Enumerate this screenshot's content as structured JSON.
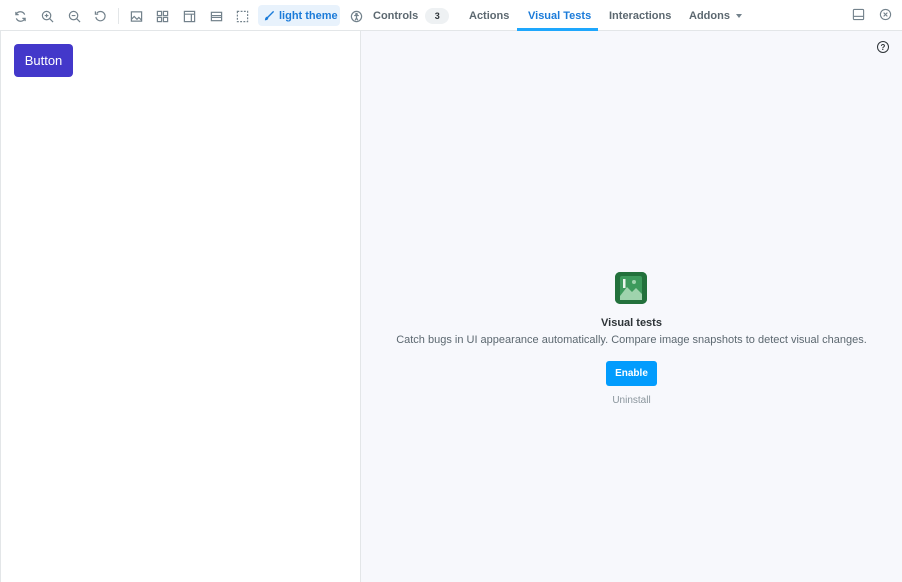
{
  "toolbar": {
    "theme_label": "light theme",
    "controls_label": "Controls",
    "controls_count": "3",
    "actions_label": "Actions",
    "visual_tests_label": "Visual Tests",
    "interactions_label": "Interactions",
    "addons_label": "Addons",
    "active_tab": "Visual Tests",
    "accent_color": "#1ea7fd"
  },
  "canvas": {
    "button_label": "Button",
    "button_color": "#4338ca"
  },
  "panel": {
    "title": "Visual tests",
    "description": "Catch bugs in UI appearance automatically. Compare image snapshots to detect visual changes.",
    "enable_label": "Enable",
    "uninstall_label": "Uninstall",
    "help_glyph": "?"
  },
  "icons": [
    "reload-icon",
    "zoom-in-icon",
    "zoom-out-icon",
    "reset-zoom-icon",
    "background-icon",
    "grid-icon",
    "outline-icon",
    "viewport-icon",
    "measure-icon",
    "brush-icon",
    "accessibility-icon",
    "panel-toggle-icon",
    "close-icon",
    "help-icon",
    "visual-tests-icon"
  ]
}
